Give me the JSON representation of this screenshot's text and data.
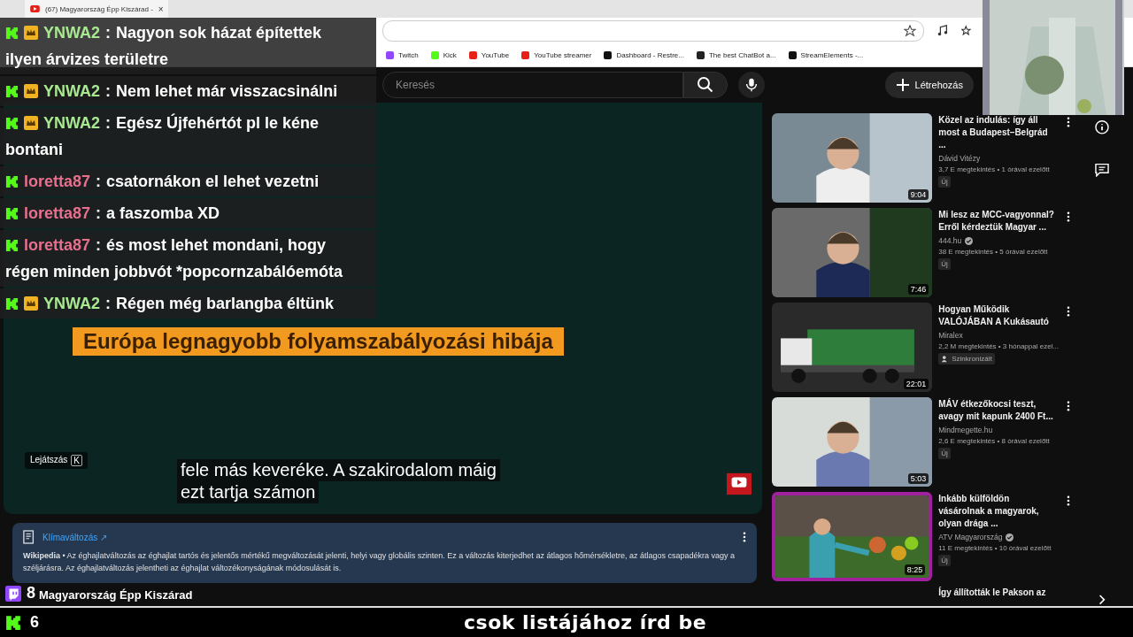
{
  "browser": {
    "tab": {
      "title": "(67) Magyarország Épp Kiszárad -",
      "close": "×"
    },
    "bookmarks": [
      "Twitch",
      "Kick",
      "YouTube",
      "YouTube streamer",
      "Dashboard - Restre...",
      "The best ChatBot a...",
      "StreamElements -..."
    ]
  },
  "youtube": {
    "search": {
      "placeholder": "Keresés"
    },
    "create": "Létrehozás",
    "player": {
      "banner": "Európa legnagyobb folyamszabályozási hibája",
      "subtitles": [
        "fele más keveréke. A szakirodalom máig",
        "ezt tartja számon"
      ],
      "tooltip": "Lejátszás",
      "tooltip_key": "K"
    },
    "info_card": {
      "title": "Klímaváltozás",
      "link_arrow": "↗",
      "text": "**Wikipedia** • Az éghajlatváltozás az éghajlat tartós és jelentős mértékű megváltozását jelenti, helyi vagy globális szinten. Ez a változás kiterjedhet az átlagos hőmérsékletre, az átlagos csapadékra vagy a széljárásra. Az éghajlatváltozás jelentheti az éghajlat változékonyságának módosulását is."
    },
    "video_title": "Magyarország Épp Kiszárad",
    "related": [
      {
        "title": "Közel az indulás: így áll most a Budapest–Belgrád ...",
        "channel": "Dávid Vitézy",
        "verified": false,
        "meta": "3,7 E megtekintés • 1 órával ezelőtt",
        "badge": {
          "label": "Új",
          "kind": "new"
        },
        "duration": "9:04",
        "highlighted": false
      },
      {
        "title": "Mi lesz az MCC-vagyonnal? Erről kérdeztük Magyar ...",
        "channel": "444.hu",
        "verified": true,
        "meta": "38 E megtekintés • 5 órával ezelőtt",
        "badge": {
          "label": "Új",
          "kind": "new"
        },
        "duration": "7:46",
        "highlighted": false
      },
      {
        "title": "Hogyan Működik VALÓJÁBAN A Kukásautó",
        "channel": "Miralex",
        "verified": false,
        "meta": "2,2 M megtekintés • 3 hónappal ezel...",
        "badge": {
          "label": "Szinkronizált",
          "kind": "dubbed"
        },
        "duration": "22:01",
        "highlighted": false
      },
      {
        "title": "MÁV étkezőkocsi teszt, avagy mit kapunk 2400 Ft...",
        "channel": "Mindmegette.hu",
        "verified": false,
        "meta": "2,6 E megtekintés • 8 órával ezelőtt",
        "badge": {
          "label": "Új",
          "kind": "new"
        },
        "duration": "5:03",
        "highlighted": false
      },
      {
        "title": "Inkább külföldön vásárolnak a magyarok, olyan drága ...",
        "channel": "ATV Magyarország",
        "verified": true,
        "meta": "11 E megtekintés • 10 órával ezelőtt",
        "badge": {
          "label": "Új",
          "kind": "new"
        },
        "duration": "8:25",
        "highlighted": true
      }
    ],
    "related_cut": "Így állították le Pakson az"
  },
  "chat": [
    {
      "crown": true,
      "user": "YNWA2",
      "color": "#a8e890",
      "separator": ":",
      "lines": [
        "Nagyon sok házat építettek",
        "ilyen árvizes területre"
      ]
    },
    {
      "crown": true,
      "user": "YNWA2",
      "color": "#a8e890",
      "separator": ":",
      "lines": [
        "Nem lehet már visszacsinálni"
      ]
    },
    {
      "crown": true,
      "user": "YNWA2",
      "color": "#a8e890",
      "separator": ":",
      "lines": [
        "Egész Újfehértót pl le kéne",
        "bontani"
      ]
    },
    {
      "crown": false,
      "user": "loretta87",
      "color": "#e8708e",
      "separator": ":",
      "lines": [
        "csatornákon el lehet vezetni"
      ]
    },
    {
      "crown": false,
      "user": "loretta87",
      "color": "#e8708e",
      "separator": ":",
      "lines": [
        "a faszomba XD"
      ]
    },
    {
      "crown": false,
      "user": "loretta87",
      "color": "#e8708e",
      "separator": ":",
      "lines": [
        "és most lehet mondani, hogy",
        "régen minden jobbvót *popcornzabálóemóta"
      ]
    },
    {
      "crown": true,
      "user": "YNWA2",
      "color": "#a8e890",
      "separator": ":",
      "lines": [
        "Régen még barlangba éltünk"
      ]
    }
  ],
  "counters": {
    "twitch": "8",
    "kick": "6"
  },
  "ticker": "csok listájához írd be"
}
